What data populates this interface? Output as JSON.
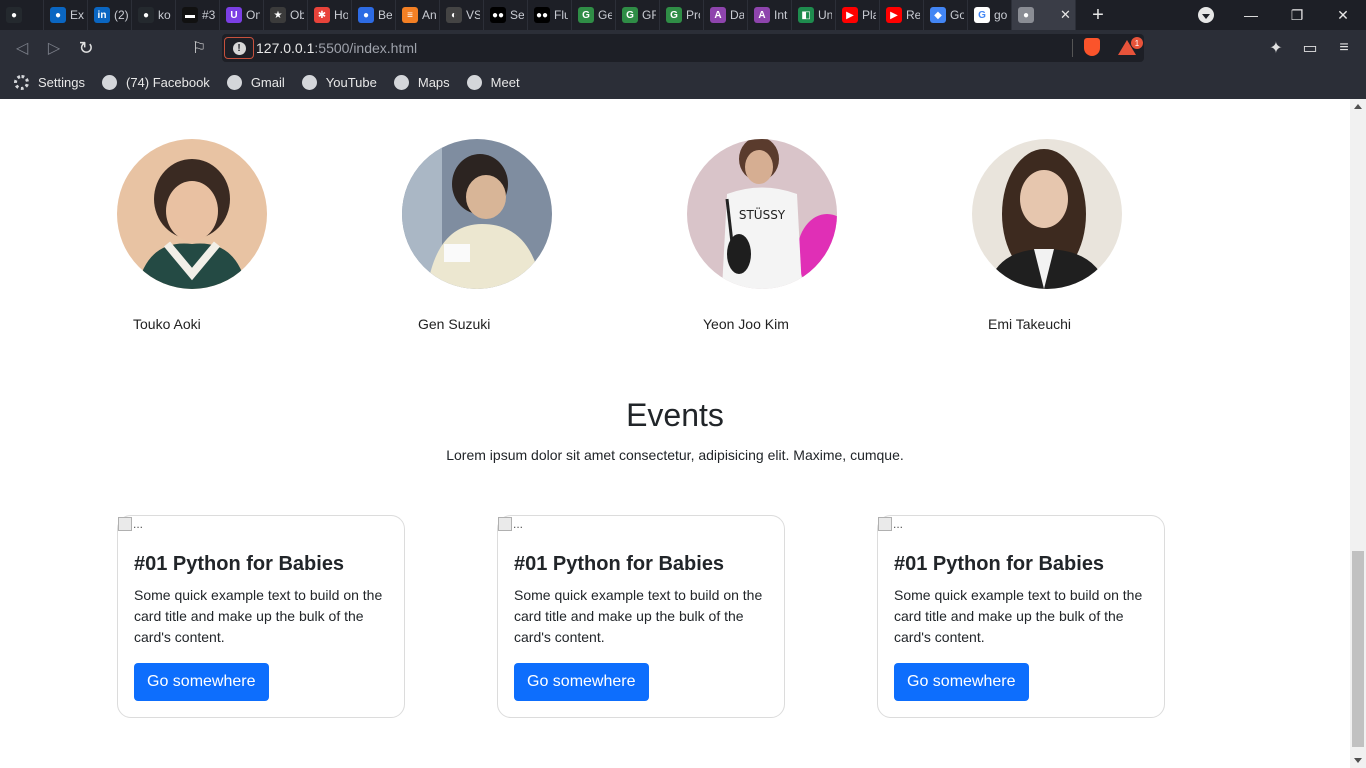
{
  "browser": {
    "tabs": [
      {
        "label": "",
        "color": "#24292e",
        "glyph": "●"
      },
      {
        "label": "Ext",
        "color": "#0a66c2",
        "glyph": "●"
      },
      {
        "label": "(2)",
        "color": "#0a66c2",
        "glyph": "in"
      },
      {
        "label": "ko",
        "color": "#24292e",
        "glyph": "●"
      },
      {
        "label": "#3",
        "color": "#111111",
        "glyph": "▬"
      },
      {
        "label": "On",
        "color": "#7b3fe4",
        "glyph": "U"
      },
      {
        "label": "Ob",
        "color": "#3b3b3b",
        "glyph": "★"
      },
      {
        "label": "Ho",
        "color": "#e8433a",
        "glyph": "✱"
      },
      {
        "label": "Be",
        "color": "#2d6be4",
        "glyph": "●"
      },
      {
        "label": "An",
        "color": "#f48024",
        "glyph": "≡"
      },
      {
        "label": "VS",
        "color": "#444444",
        "glyph": "◐"
      },
      {
        "label": "Se",
        "color": "#000000",
        "glyph": "●●"
      },
      {
        "label": "Flu",
        "color": "#000000",
        "glyph": "●●"
      },
      {
        "label": "Ge",
        "color": "#2f8d46",
        "glyph": "G"
      },
      {
        "label": "GF",
        "color": "#2f8d46",
        "glyph": "G"
      },
      {
        "label": "Pro",
        "color": "#2f8d46",
        "glyph": "G"
      },
      {
        "label": "Da",
        "color": "#8e44ad",
        "glyph": "A"
      },
      {
        "label": "Int",
        "color": "#8e44ad",
        "glyph": "A"
      },
      {
        "label": "Un",
        "color": "#1e8c4e",
        "glyph": "◧"
      },
      {
        "label": "Pla",
        "color": "#ff0000",
        "glyph": "▶"
      },
      {
        "label": "Re",
        "color": "#ff0000",
        "glyph": "▶"
      },
      {
        "label": "Go",
        "color": "#4285f4",
        "glyph": "◆"
      },
      {
        "label": "go",
        "color": "#ffffff",
        "glyph": "G"
      },
      {
        "label": "",
        "color": "#8a8d94",
        "glyph": "●",
        "active": true
      }
    ],
    "url_host": "127.0.0.1",
    "url_path": ":5500/index.html",
    "rewards_count": "1",
    "bookmarks": [
      {
        "label": "Settings",
        "icon": "gear-icon"
      },
      {
        "label": "(74) Facebook",
        "icon": "globe-icon"
      },
      {
        "label": "Gmail",
        "icon": "globe-icon"
      },
      {
        "label": "YouTube",
        "icon": "globe-icon"
      },
      {
        "label": "Maps",
        "icon": "globe-icon"
      },
      {
        "label": "Meet",
        "icon": "globe-icon"
      }
    ]
  },
  "team": [
    {
      "name": "Touko Aoki"
    },
    {
      "name": "Gen Suzuki"
    },
    {
      "name": "Yeon Joo Kim"
    },
    {
      "name": "Emi Takeuchi"
    }
  ],
  "events": {
    "title": "Events",
    "subtitle": "Lorem ipsum dolor sit amet consectetur, adipisicing elit. Maxime, cumque.",
    "cards": [
      {
        "img_alt": "...",
        "title": "#01 Python for Babies",
        "text": "Some quick example text to build on the card title and make up the bulk of the card's content.",
        "button": "Go somewhere"
      },
      {
        "img_alt": "...",
        "title": "#01 Python for Babies",
        "text": "Some quick example text to build on the card title and make up the bulk of the card's content.",
        "button": "Go somewhere"
      },
      {
        "img_alt": "...",
        "title": "#01 Python for Babies",
        "text": "Some quick example text to build on the card title and make up the bulk of the card's content.",
        "button": "Go somewhere"
      }
    ]
  },
  "colors": {
    "primary_button": "#0d6efd",
    "chrome_dark": "#1d1f26",
    "toolbar": "#2b2e37"
  }
}
